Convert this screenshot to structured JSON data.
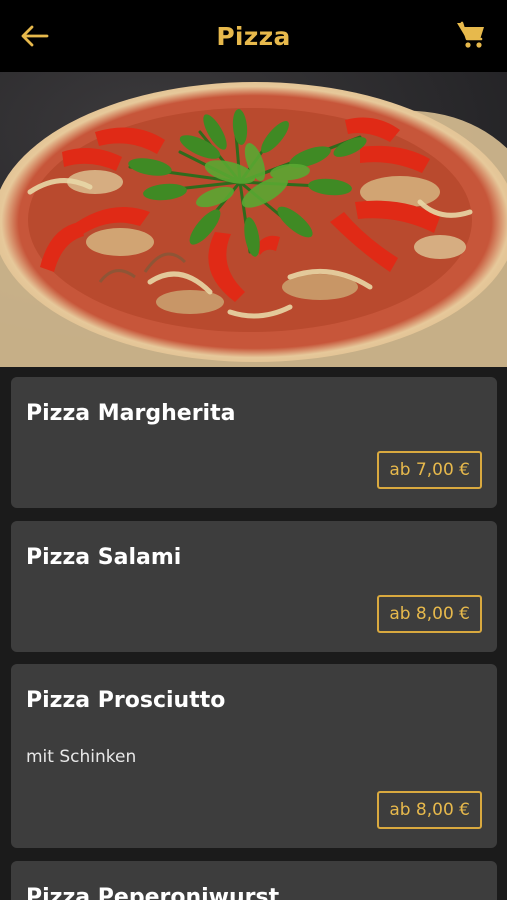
{
  "header": {
    "title": "Pizza",
    "back_icon": "arrow-left-icon",
    "cart_icon": "shopping-cart-icon",
    "accent_color": "#e7b94c"
  },
  "menu": {
    "items": [
      {
        "name": "Pizza Margherita",
        "description": "",
        "price": "ab 7,00 €"
      },
      {
        "name": "Pizza Salami",
        "description": "",
        "price": "ab 8,00 €"
      },
      {
        "name": "Pizza Prosciutto",
        "description": "mit Schinken",
        "price": "ab 8,00 €"
      },
      {
        "name": "Pizza Peperoniwurst",
        "description": "",
        "price": ""
      }
    ]
  }
}
